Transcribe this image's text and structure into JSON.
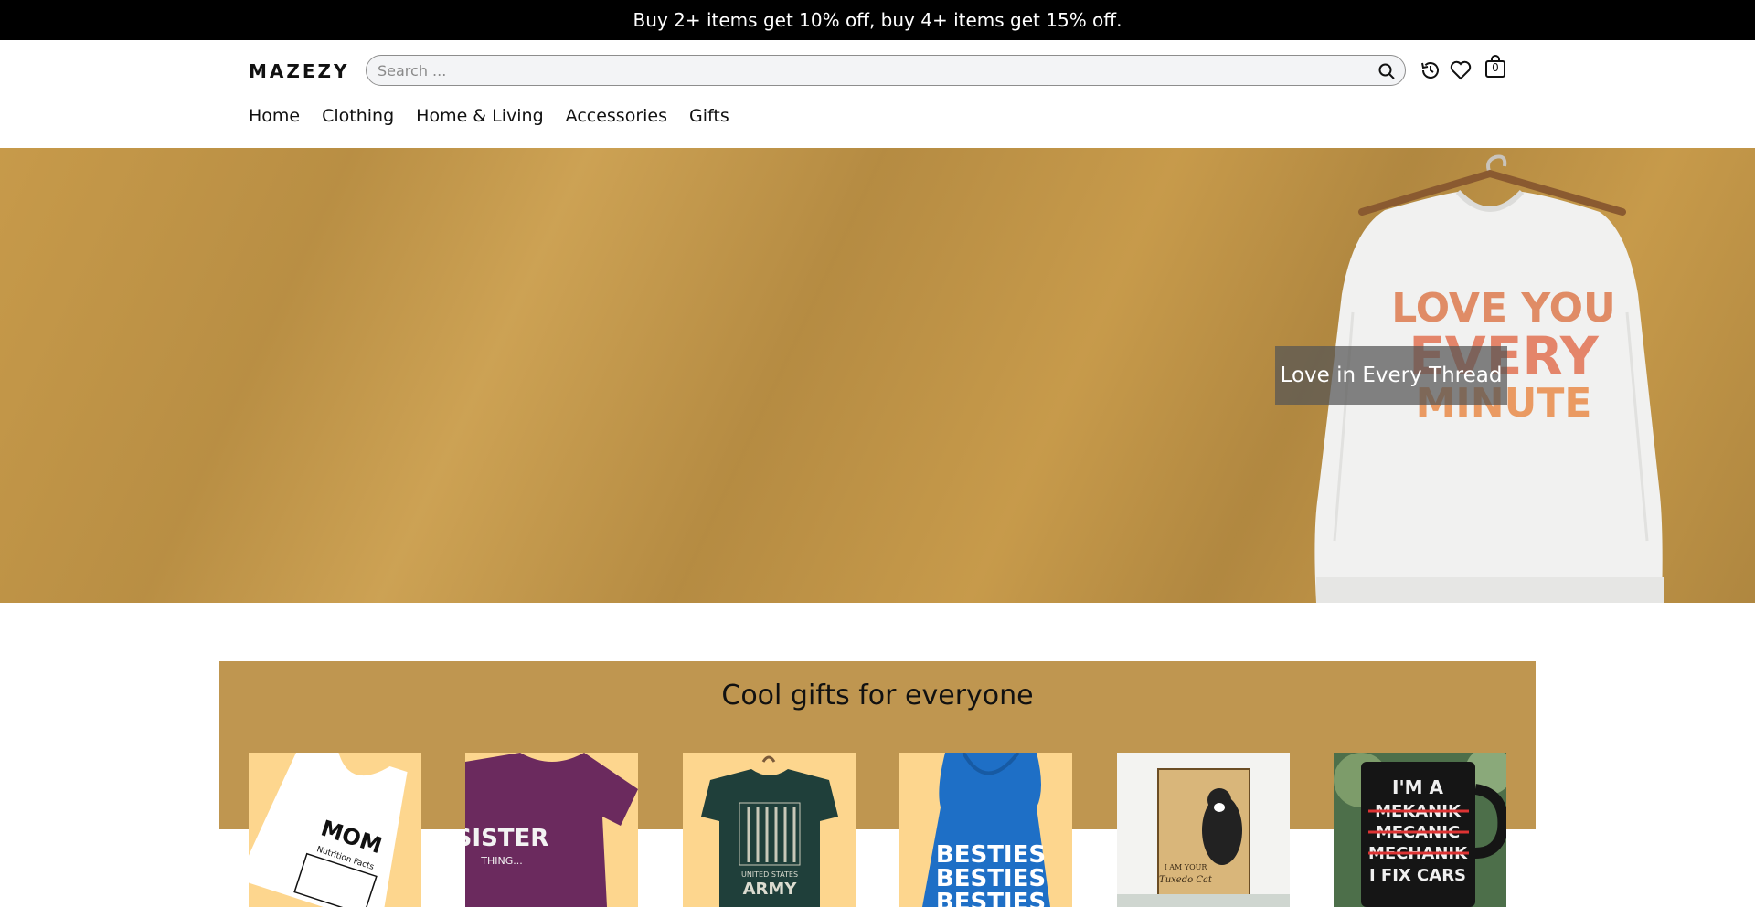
{
  "announcement": "Buy 2+ items get 10% off, buy 4+ items get 15% off.",
  "header": {
    "logo": "MAZEZY",
    "search_placeholder": "Search ...",
    "cart_count": "0",
    "icons": [
      "search-icon",
      "history-icon",
      "heart-icon",
      "bag-icon"
    ]
  },
  "nav": [
    "Home",
    "Clothing",
    "Home & Living",
    "Accessories",
    "Gifts"
  ],
  "hero": {
    "caption": "Love in Every Thread",
    "sweater_text": [
      "LOVE YOU",
      "EVERY",
      "MINUTE"
    ]
  },
  "gifts": {
    "title": "Cool gifts for everyone",
    "products": [
      {
        "name": "mom-tank-top",
        "print_text": [
          "MOM",
          "Nutrition Facts"
        ]
      },
      {
        "name": "sister-tshirt",
        "print_text": [
          "SISTER",
          "THING..."
        ]
      },
      {
        "name": "army-tshirt",
        "print_text": [
          "UNITED STATES",
          "ARMY"
        ]
      },
      {
        "name": "besties-hoodie",
        "print_text": [
          "BESTIES",
          "BESTIES",
          "BESTIES"
        ]
      },
      {
        "name": "cat-poster",
        "print_text": [
          "I AM YOUR",
          "Tuxedo Cat"
        ]
      },
      {
        "name": "mechanic-mug",
        "print_text": [
          "I'M A",
          "MEKANIK",
          "MECANIC",
          "MECHANIK",
          "I FIX CARS"
        ]
      }
    ]
  },
  "colors": {
    "hero_bg": "#c79a4a",
    "band_bg": "#bf9650",
    "card_bg": "#fdd68e",
    "sweater_print": "#e8866a"
  }
}
